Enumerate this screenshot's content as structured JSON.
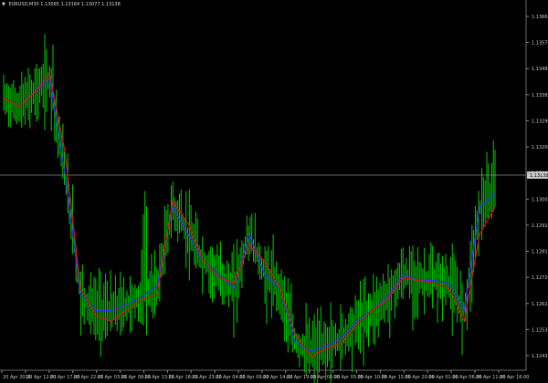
{
  "header": {
    "symbol_timeframe": "EURUSD,M30",
    "quotes": "1.13065 1.13164 1.13077 1.13138"
  },
  "price_scale": {
    "labels": [
      "1.13665",
      "1.13570",
      "1.13480",
      "1.13385",
      "1.13290",
      "1.13200",
      "1.13105",
      "1.13005",
      "1.12910",
      "1.12815",
      "1.12720",
      "1.12625",
      "1.12530",
      "1.12435"
    ]
  },
  "current_price": {
    "label": "1.13138",
    "value": 1.13138
  },
  "time_scale": {
    "labels": [
      "20 Apr 2016",
      "20 Apr 12:00",
      "20 Apr 17:00",
      "20 Apr 22:00",
      "21 Apr 03:00",
      "21 Apr 08:00",
      "21 Apr 13:00",
      "21 Apr 18:00",
      "21 Apr 23:00",
      "22 Apr 04:00",
      "22 Apr 09:00",
      "22 Apr 14:00",
      "22 Apr 19:00",
      "25 Apr 00:00",
      "25 Apr 05:00",
      "25 Apr 10:00",
      "25 Apr 15:00",
      "25 Apr 20:00",
      "26 Apr 01:00",
      "26 Apr 06:00",
      "26 Apr 11:00",
      "26 Apr 16:00"
    ]
  },
  "colors": {
    "background": "#000000",
    "bars": "#00cc00",
    "ma_fast": "#3030ff",
    "ma_slow": "#e01010",
    "current_line": "#8c8c8c",
    "axis_text": "#c8c8c8"
  },
  "chart_data": {
    "type": "line",
    "price_range": [
      1.124,
      1.1372
    ],
    "series": [
      {
        "name": "",
        "color": "#3030ff",
        "values": [
          1.134,
          1.1337,
          1.1342,
          1.1347,
          1.1312,
          1.1268,
          1.1262,
          1.1262,
          1.1264,
          1.1267,
          1.1271,
          1.13,
          1.129,
          1.128,
          1.1275,
          1.127,
          1.129,
          1.1275,
          1.127,
          1.125,
          1.1247,
          1.1249,
          1.1252,
          1.1258,
          1.1262,
          1.1267,
          1.1275,
          1.1273,
          1.1273,
          1.1272,
          1.1262,
          1.13,
          1.1305
        ]
      },
      {
        "name": "",
        "color": "#e01010",
        "values": [
          1.134,
          1.1337,
          1.1342,
          1.1349,
          1.132,
          1.127,
          1.126,
          1.1258,
          1.1262,
          1.1266,
          1.1268,
          1.1302,
          1.1294,
          1.128,
          1.1274,
          1.1272,
          1.1286,
          1.128,
          1.127,
          1.1253,
          1.1245,
          1.1248,
          1.125,
          1.1257,
          1.1262,
          1.1266,
          1.1274,
          1.1273,
          1.1272,
          1.127,
          1.1258,
          1.129,
          1.13
        ]
      }
    ],
    "bars_ohlc_sample": "M30 candles (green) in the range 1.1240-1.1372"
  }
}
